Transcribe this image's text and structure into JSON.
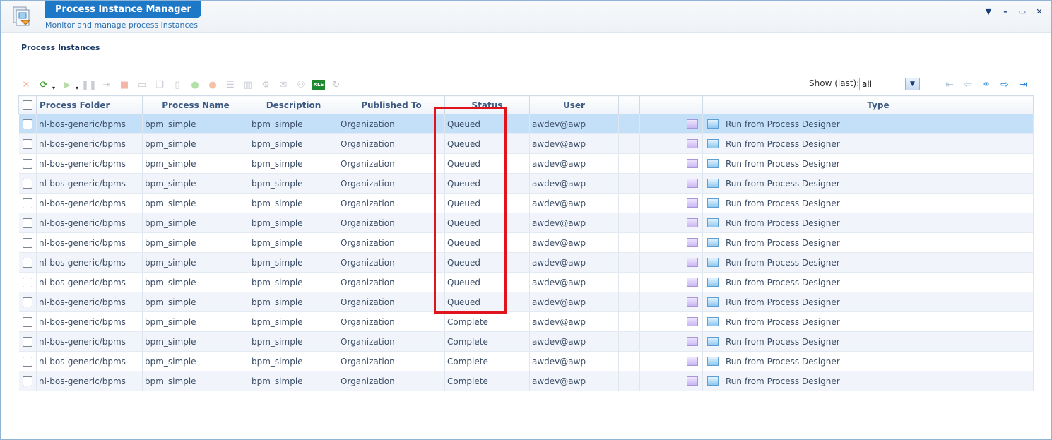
{
  "window": {
    "title": "Process Instance Manager",
    "subtitle": "Monitor and manage process instances",
    "controls": [
      "▼",
      "–",
      "▭",
      "✕"
    ]
  },
  "section_title": "Process Instances",
  "toolbar": {
    "icons": [
      "delete-icon",
      "refresh-icon",
      "run-icon",
      "pause-icon",
      "resume-icon",
      "stop-icon",
      "comment-icon",
      "copy-icon",
      "document-icon",
      "green-circle-icon",
      "orange-circle-icon",
      "list-icon",
      "barcode-icon",
      "settings-icon",
      "mail-icon",
      "tree-icon",
      "excel-export-icon",
      "reload-icon"
    ],
    "xls_label": "XLS"
  },
  "show_last": {
    "label": "Show (last):",
    "value": "all"
  },
  "columns": [
    "Process Folder",
    "Process Name",
    "Description",
    "Published To",
    "Status",
    "User",
    "",
    "",
    "",
    "",
    "",
    "Type"
  ],
  "rows": [
    {
      "folder": "nl-bos-generic/bpms",
      "name": "bpm_simple",
      "description": "bpm_simple",
      "published": "Organization",
      "status": "Queued",
      "user": "awdev@awp",
      "type": "Run from Process Designer"
    },
    {
      "folder": "nl-bos-generic/bpms",
      "name": "bpm_simple",
      "description": "bpm_simple",
      "published": "Organization",
      "status": "Queued",
      "user": "awdev@awp",
      "type": "Run from Process Designer"
    },
    {
      "folder": "nl-bos-generic/bpms",
      "name": "bpm_simple",
      "description": "bpm_simple",
      "published": "Organization",
      "status": "Queued",
      "user": "awdev@awp",
      "type": "Run from Process Designer"
    },
    {
      "folder": "nl-bos-generic/bpms",
      "name": "bpm_simple",
      "description": "bpm_simple",
      "published": "Organization",
      "status": "Queued",
      "user": "awdev@awp",
      "type": "Run from Process Designer"
    },
    {
      "folder": "nl-bos-generic/bpms",
      "name": "bpm_simple",
      "description": "bpm_simple",
      "published": "Organization",
      "status": "Queued",
      "user": "awdev@awp",
      "type": "Run from Process Designer"
    },
    {
      "folder": "nl-bos-generic/bpms",
      "name": "bpm_simple",
      "description": "bpm_simple",
      "published": "Organization",
      "status": "Queued",
      "user": "awdev@awp",
      "type": "Run from Process Designer"
    },
    {
      "folder": "nl-bos-generic/bpms",
      "name": "bpm_simple",
      "description": "bpm_simple",
      "published": "Organization",
      "status": "Queued",
      "user": "awdev@awp",
      "type": "Run from Process Designer"
    },
    {
      "folder": "nl-bos-generic/bpms",
      "name": "bpm_simple",
      "description": "bpm_simple",
      "published": "Organization",
      "status": "Queued",
      "user": "awdev@awp",
      "type": "Run from Process Designer"
    },
    {
      "folder": "nl-bos-generic/bpms",
      "name": "bpm_simple",
      "description": "bpm_simple",
      "published": "Organization",
      "status": "Queued",
      "user": "awdev@awp",
      "type": "Run from Process Designer"
    },
    {
      "folder": "nl-bos-generic/bpms",
      "name": "bpm_simple",
      "description": "bpm_simple",
      "published": "Organization",
      "status": "Queued",
      "user": "awdev@awp",
      "type": "Run from Process Designer"
    },
    {
      "folder": "nl-bos-generic/bpms",
      "name": "bpm_simple",
      "description": "bpm_simple",
      "published": "Organization",
      "status": "Complete",
      "user": "awdev@awp",
      "type": "Run from Process Designer"
    },
    {
      "folder": "nl-bos-generic/bpms",
      "name": "bpm_simple",
      "description": "bpm_simple",
      "published": "Organization",
      "status": "Complete",
      "user": "awdev@awp",
      "type": "Run from Process Designer"
    },
    {
      "folder": "nl-bos-generic/bpms",
      "name": "bpm_simple",
      "description": "bpm_simple",
      "published": "Organization",
      "status": "Complete",
      "user": "awdev@awp",
      "type": "Run from Process Designer"
    },
    {
      "folder": "nl-bos-generic/bpms",
      "name": "bpm_simple",
      "description": "bpm_simple",
      "published": "Organization",
      "status": "Complete",
      "user": "awdev@awp",
      "type": "Run from Process Designer"
    }
  ],
  "selected_row": 0,
  "colors": {
    "accent": "#1e78c8",
    "queued": "#1f25b5",
    "complete": "#1d7a1d",
    "highlight": "#e0141d",
    "selected_row": "#c3e0f8"
  }
}
